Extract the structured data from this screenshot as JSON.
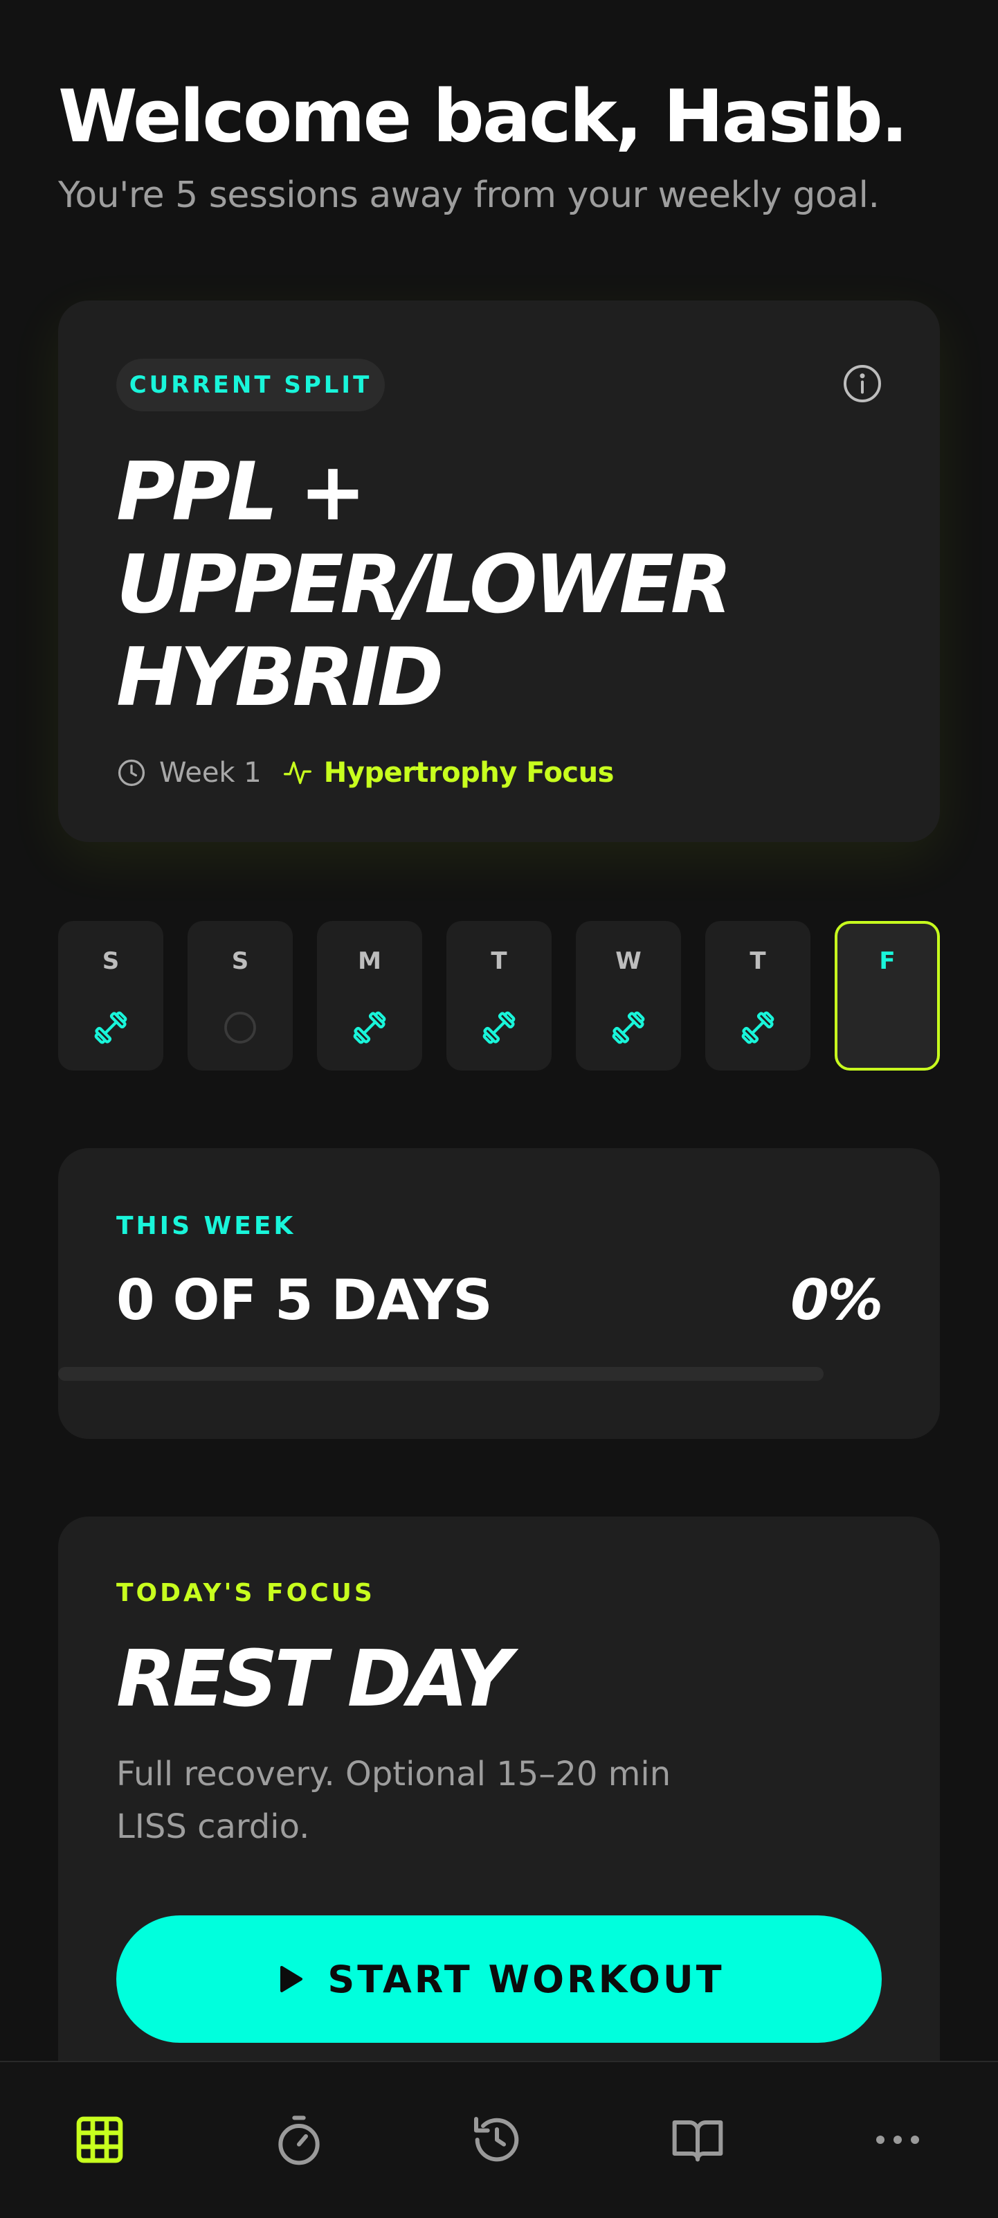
{
  "header": {
    "welcome": "Welcome back, Hasib.",
    "subtitle": "You're 5 sessions away from your weekly goal."
  },
  "split_card": {
    "pill_label": "CURRENT SPLIT",
    "title_lines": [
      "PPL +",
      "UPPER/LOWER",
      "HYBRID"
    ],
    "week_label": "Week 1",
    "focus_label": "Hypertrophy Focus",
    "icons": {
      "info": "info-icon",
      "clock": "clock-icon",
      "pulse": "activity-icon"
    }
  },
  "week_days": [
    {
      "letter": "S",
      "status": "workout"
    },
    {
      "letter": "S",
      "status": "rest"
    },
    {
      "letter": "M",
      "status": "workout"
    },
    {
      "letter": "T",
      "status": "workout"
    },
    {
      "letter": "W",
      "status": "workout"
    },
    {
      "letter": "T",
      "status": "workout"
    },
    {
      "letter": "F",
      "status": "today"
    }
  ],
  "this_week": {
    "eyebrow": "THIS WEEK",
    "days_text": "0 OF 5 DAYS",
    "percent_text": "0%",
    "progress": 0
  },
  "today_focus": {
    "eyebrow": "TODAY'S FOCUS",
    "title": "REST DAY",
    "description": "Full recovery. Optional 15–20 min LISS cardio.",
    "button_label": "START WORKOUT"
  },
  "bottom_nav": [
    {
      "icon": "grid-icon",
      "active": true
    },
    {
      "icon": "timer-icon",
      "active": false
    },
    {
      "icon": "history-icon",
      "active": false
    },
    {
      "icon": "book-icon",
      "active": false
    },
    {
      "icon": "more-icon",
      "active": false
    }
  ],
  "colors": {
    "background": "#121212",
    "card": "#1f1f1f",
    "cyan": "#19f5da",
    "lime": "#c8ff1e",
    "button": "#00ffdd"
  }
}
